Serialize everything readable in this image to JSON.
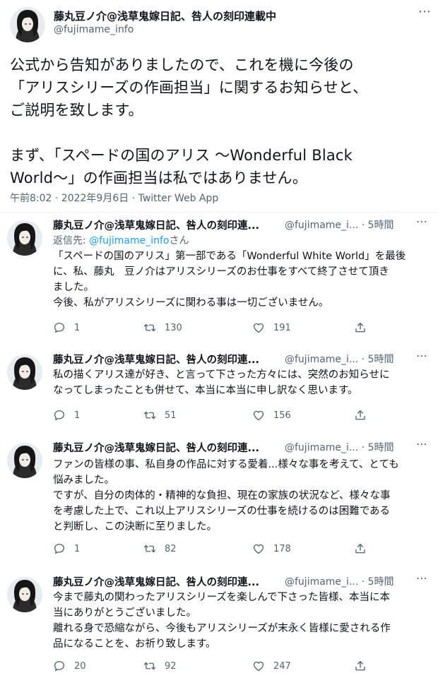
{
  "main_tweet": {
    "display_name": "藤丸豆ノ介@浅草鬼嫁日記、咎人の刻印連載中",
    "handle": "@fujimame_info",
    "more_icon": "more-horizontal-icon",
    "text": "公式から告知がありましたので、これを機に今後の\n「アリスシリーズの作画担当」に関するお知らせと、\nご説明を致します。\n\nまず、「スペードの国のアリス 〜Wonderful Black\nWorld〜」の作画担当は私ではありません。",
    "meta": "午前8:02 · 2022年9月6日 · Twitter Web App"
  },
  "replies": [
    {
      "display_name": "藤丸豆ノ介@浅草鬼嫁日記、咎人の刻印連...",
      "handle": "@fujimame_i...",
      "time": "· 5時間",
      "reply_to_prefix": "返信先: ",
      "reply_to_handle": "@fujimame_info",
      "reply_to_suffix": "さん",
      "text": "「スペードの国のアリス」第一部である「Wonderful White World」を最後\nに、私、藤丸　豆ノ介はアリスシリーズのお仕事をすべて終了させて頂き\nました。\n今後、私がアリスシリーズに関わる事は一切ございません。",
      "reply_count": "1",
      "retweet_count": "130",
      "like_count": "191"
    },
    {
      "display_name": "藤丸豆ノ介@浅草鬼嫁日記、咎人の刻印連...",
      "handle": "@fujimame_i...",
      "time": "· 5時間",
      "text": "私の描くアリス達が好き、と言って下さった方々には、突然のお知らせに\nなってしまったことも併せて、本当に本当に申し訳なく思います。",
      "reply_count": "1",
      "retweet_count": "51",
      "like_count": "156"
    },
    {
      "display_name": "藤丸豆ノ介@浅草鬼嫁日記、咎人の刻印連...",
      "handle": "@fujimame_i...",
      "time": "· 5時間",
      "text": "ファンの皆様の事、私自身の作品に対する愛着...様々な事を考えて、とても\n悩みました。\nですが、自分の肉体的・精神的な負担、現在の家族の状況など、様々な事\nを考慮した上で、これ以上アリスシリーズの仕事を続けるのは困難である\nと判断し、この決断に至りました。",
      "reply_count": "1",
      "retweet_count": "82",
      "like_count": "178"
    },
    {
      "display_name": "藤丸豆ノ介@浅草鬼嫁日記、咎人の刻印連...",
      "handle": "@fujimame_i...",
      "time": "· 5時間",
      "text": "今まで藤丸の関わったアリスシリーズを楽しんで下さった皆様、本当に本\n当にありがとうございました。\n離れる身で恐縮ながら、今後もアリスシリーズが末永く皆様に愛される作\n品になることを、お祈り致します。",
      "reply_count": "20",
      "retweet_count": "92",
      "like_count": "247"
    }
  ],
  "icons": {
    "reply": "reply-icon",
    "retweet": "retweet-icon",
    "like": "heart-icon",
    "share": "share-icon",
    "avatar": "avatar"
  },
  "colors": {
    "text": "#0f1419",
    "secondary": "#536471",
    "link": "#1d9bf0",
    "divider": "#eff3f4"
  }
}
